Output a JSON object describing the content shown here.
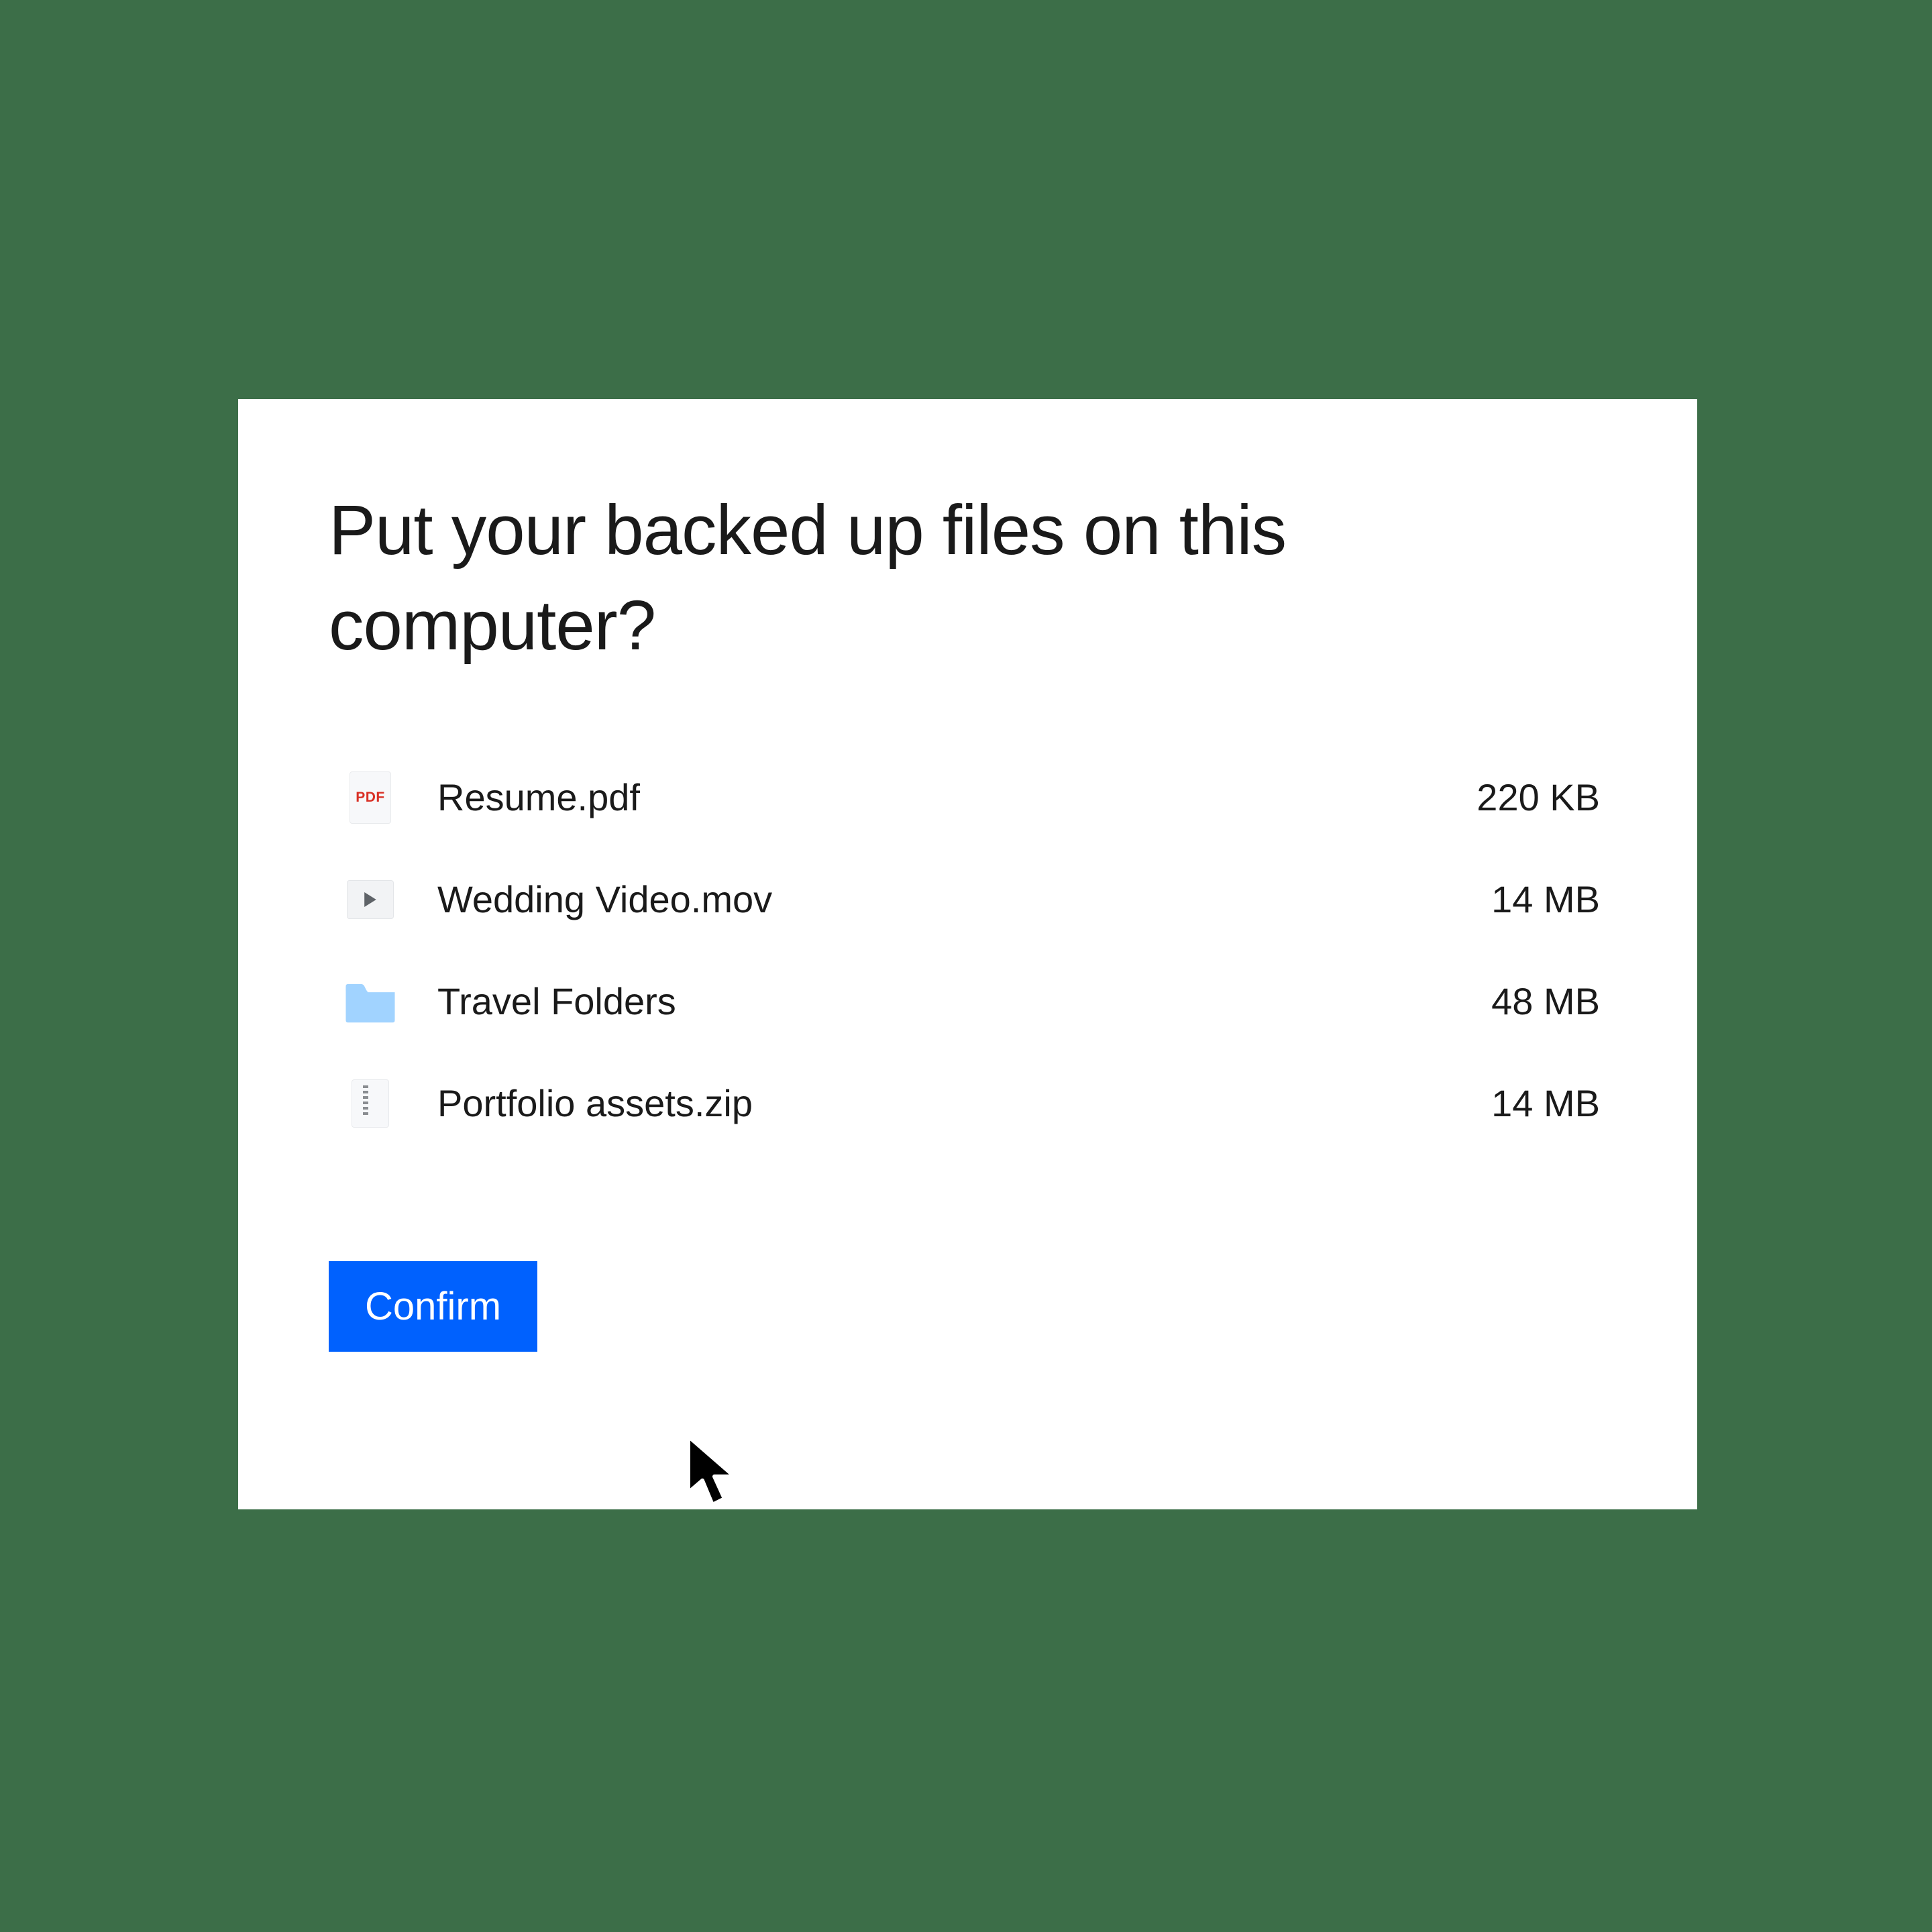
{
  "dialog": {
    "title": "Put your backed up files on this computer?",
    "confirm_label": "Confirm"
  },
  "files": [
    {
      "icon": "pdf",
      "name": "Resume.pdf",
      "size": "220 KB"
    },
    {
      "icon": "video",
      "name": "Wedding Video.mov",
      "size": "14 MB"
    },
    {
      "icon": "folder",
      "name": "Travel Folders",
      "size": "48 MB"
    },
    {
      "icon": "zip",
      "name": "Portfolio assets.zip",
      "size": "14 MB"
    }
  ]
}
